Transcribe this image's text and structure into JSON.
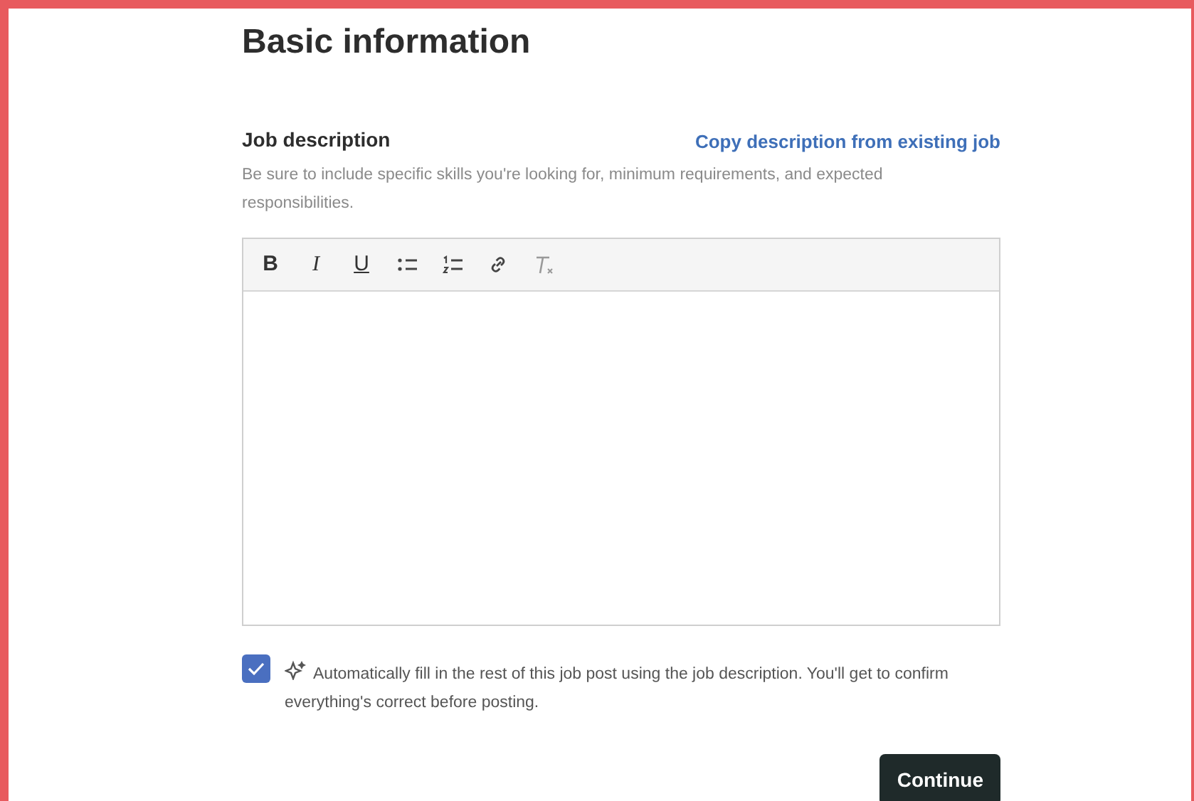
{
  "heading": "Basic information",
  "field": {
    "label": "Job description",
    "link": "Copy description from existing job",
    "help": "Be sure to include specific skills you're looking for, minimum requirements, and expected responsibilities."
  },
  "toolbar": [
    {
      "kind": "bold",
      "label": "B"
    },
    {
      "kind": "italic",
      "label": "I"
    },
    {
      "kind": "underline",
      "label": "U"
    },
    {
      "kind": "bullets"
    },
    {
      "kind": "numbers"
    },
    {
      "kind": "link"
    },
    {
      "kind": "clear"
    }
  ],
  "autofill": {
    "checked": true,
    "text": "Automatically fill in the rest of this job post using the job description. You'll get to confirm everything's correct before posting."
  },
  "continue_button": "Continue"
}
